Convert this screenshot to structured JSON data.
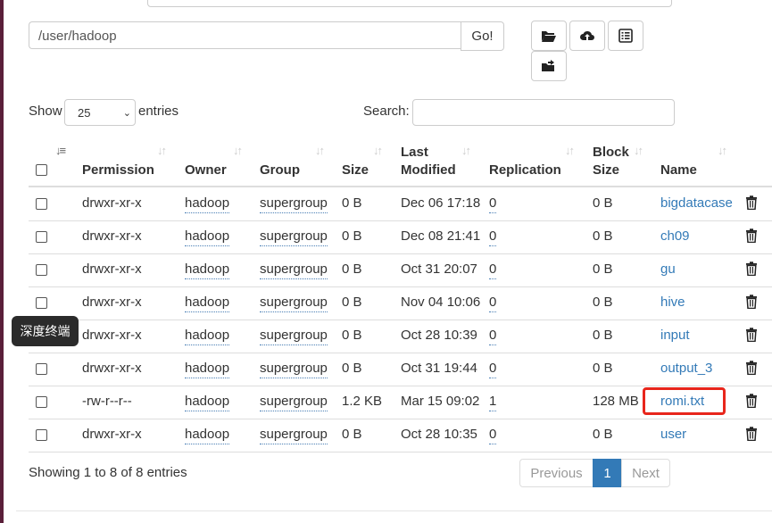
{
  "path_bar": {
    "value": "/user/hadoop",
    "go_label": "Go!"
  },
  "toolbar": {
    "icons": [
      "folder-open-icon",
      "cloud-upload-icon",
      "list-icon",
      "move-folder-icon"
    ]
  },
  "controls": {
    "show_label": "Show",
    "page_size": "25",
    "entries_label": "entries",
    "search_label": "Search:",
    "search_value": ""
  },
  "table": {
    "headers": {
      "permission": "Permission",
      "owner": "Owner",
      "group": "Group",
      "size": "Size",
      "last1": "Last",
      "last2": "Modified",
      "replication": "Replication",
      "block1": "Block",
      "block2": "Size",
      "name": "Name"
    },
    "rows": [
      {
        "permission": "drwxr-xr-x",
        "owner": "hadoop",
        "group": "supergroup",
        "size": "0 B",
        "modified": "Dec 06 17:18",
        "replication": "0",
        "block_size": "0 B",
        "name": "bigdatacase"
      },
      {
        "permission": "drwxr-xr-x",
        "owner": "hadoop",
        "group": "supergroup",
        "size": "0 B",
        "modified": "Dec 08 21:41",
        "replication": "0",
        "block_size": "0 B",
        "name": "ch09"
      },
      {
        "permission": "drwxr-xr-x",
        "owner": "hadoop",
        "group": "supergroup",
        "size": "0 B",
        "modified": "Oct 31 20:07",
        "replication": "0",
        "block_size": "0 B",
        "name": "gu"
      },
      {
        "permission": "drwxr-xr-x",
        "owner": "hadoop",
        "group": "supergroup",
        "size": "0 B",
        "modified": "Nov 04 10:06",
        "replication": "0",
        "block_size": "0 B",
        "name": "hive"
      },
      {
        "permission": "drwxr-xr-x",
        "owner": "hadoop",
        "group": "supergroup",
        "size": "0 B",
        "modified": "Oct 28 10:39",
        "replication": "0",
        "block_size": "0 B",
        "name": "input"
      },
      {
        "permission": "drwxr-xr-x",
        "owner": "hadoop",
        "group": "supergroup",
        "size": "0 B",
        "modified": "Oct 31 19:44",
        "replication": "0",
        "block_size": "0 B",
        "name": "output_3"
      },
      {
        "permission": "-rw-r--r--",
        "owner": "hadoop",
        "group": "supergroup",
        "size": "1.2 KB",
        "modified": "Mar 15 09:02",
        "replication": "1",
        "block_size": "128 MB",
        "name": "romi.txt"
      },
      {
        "permission": "drwxr-xr-x",
        "owner": "hadoop",
        "group": "supergroup",
        "size": "0 B",
        "modified": "Oct 28 10:35",
        "replication": "0",
        "block_size": "0 B",
        "name": "user"
      }
    ]
  },
  "tooltip": {
    "text": "深度终端"
  },
  "footer": {
    "info": "Showing 1 to 8 of 8 entries",
    "previous": "Previous",
    "page": "1",
    "next": "Next"
  },
  "colors": {
    "link": "#337ab7",
    "active_page": "#337ab7",
    "highlight": "#e8261c"
  }
}
